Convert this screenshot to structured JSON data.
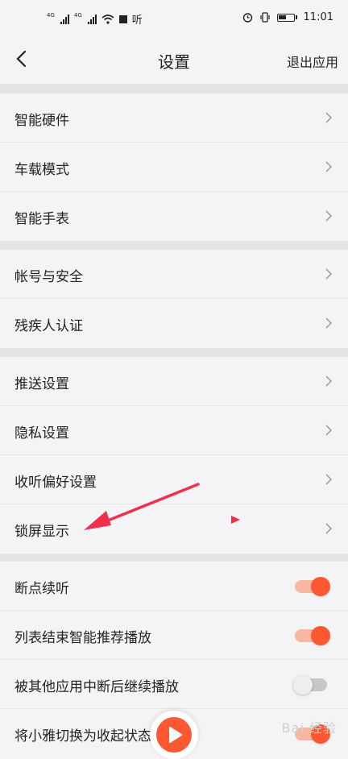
{
  "status_bar": {
    "network1": "4G",
    "network2": "4G",
    "app_label": "听",
    "time": "11:01"
  },
  "header": {
    "title": "设置",
    "exit_label": "退出应用"
  },
  "groups": [
    {
      "items": [
        {
          "label": "智能硬件",
          "type": "link"
        },
        {
          "label": "车载模式",
          "type": "link"
        },
        {
          "label": "智能手表",
          "type": "link"
        }
      ]
    },
    {
      "items": [
        {
          "label": "帐号与安全",
          "type": "link"
        },
        {
          "label": "残疾人认证",
          "type": "link"
        }
      ]
    },
    {
      "items": [
        {
          "label": "推送设置",
          "type": "link"
        },
        {
          "label": "隐私设置",
          "type": "link"
        },
        {
          "label": "收听偏好设置",
          "type": "link"
        },
        {
          "label": "锁屏显示",
          "type": "link"
        }
      ]
    },
    {
      "items": [
        {
          "label": "断点续听",
          "type": "toggle",
          "on": true
        },
        {
          "label": "列表结束智能推荐播放",
          "type": "toggle",
          "on": true
        },
        {
          "label": "被其他应用中断后继续播放",
          "type": "toggle",
          "on": false
        },
        {
          "label": "将小雅切换为收起状态",
          "type": "toggle",
          "on": true
        }
      ]
    }
  ],
  "watermark": "Bai 经验",
  "colors": {
    "accent": "#fc5832",
    "annotation_arrow": "#f0304a"
  }
}
